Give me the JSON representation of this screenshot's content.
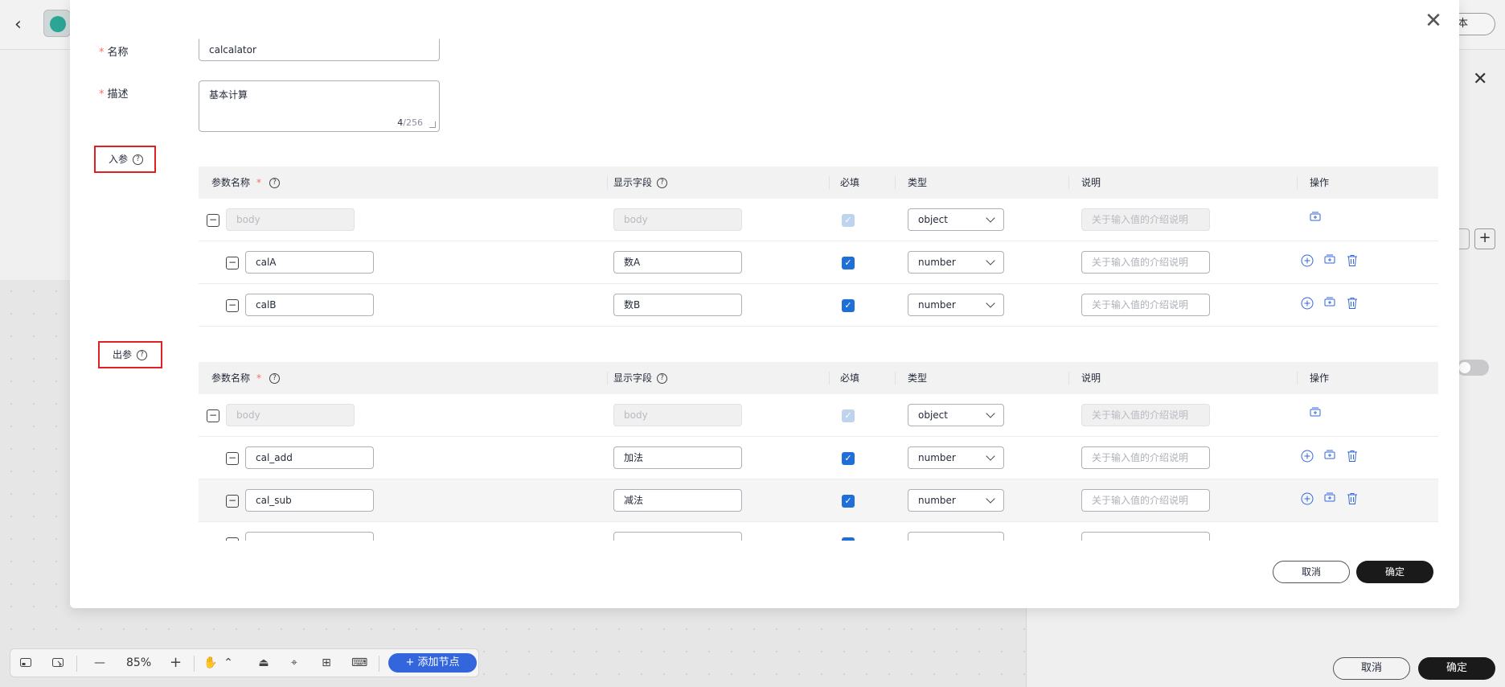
{
  "background": {
    "header_button_label": "本",
    "toolbar": {
      "zoom": "85%",
      "add_node_label": "+ 添加节点"
    },
    "side_panel": {
      "cancel_label": "取消",
      "ok_label": "确定"
    }
  },
  "modal": {
    "name_label": "名称",
    "name_value": "calcalator",
    "desc_label": "描述",
    "desc_value": "基本计算",
    "desc_count": "4",
    "desc_max": "/256",
    "input_section_label": "入参",
    "output_section_label": "出参",
    "columns": {
      "param_name": "参数名称",
      "display_field": "显示字段",
      "required": "必填",
      "type": "类型",
      "description": "说明",
      "actions": "操作"
    },
    "description_placeholder": "关于输入值的介绍说明",
    "input_rows": [
      {
        "name": "body",
        "display": "body",
        "type": "object",
        "root": true
      },
      {
        "name": "calA",
        "display": "数A",
        "type": "number",
        "root": false
      },
      {
        "name": "calB",
        "display": "数B",
        "type": "number",
        "root": false
      }
    ],
    "output_rows": [
      {
        "name": "body",
        "display": "body",
        "type": "object",
        "root": true
      },
      {
        "name": "cal_add",
        "display": "加法",
        "type": "number",
        "root": false
      },
      {
        "name": "cal_sub",
        "display": "减法",
        "type": "number",
        "root": false
      }
    ],
    "cancel_label": "取消",
    "ok_label": "确定"
  },
  "colors": {
    "primary": "#1f6fd8",
    "accent_blue": "#3366dd",
    "required_star": "#f66f6a",
    "highlight_box": "#e02020",
    "primary_button": "#1a1a1a"
  }
}
